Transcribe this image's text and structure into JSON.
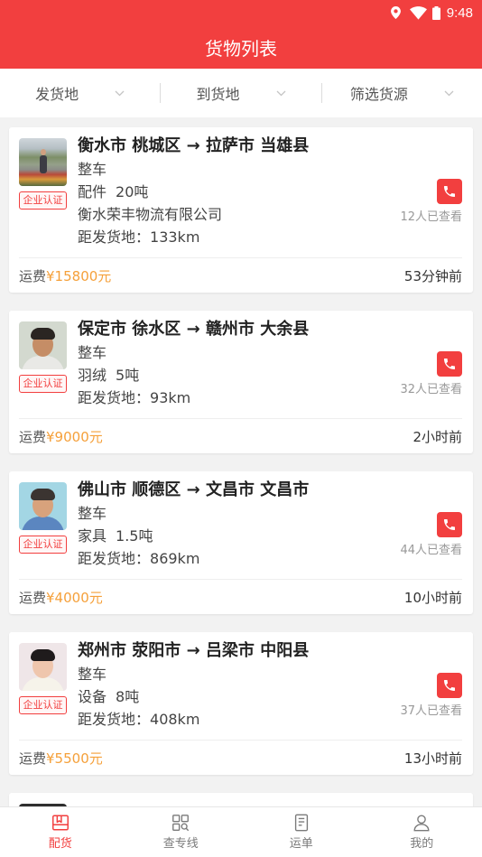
{
  "theme": {
    "primary": "#f23f3f",
    "fee": "#f5a03a",
    "background": "#f2f2f2"
  },
  "status_bar": {
    "time": "9:48",
    "icons": [
      "location-icon",
      "wifi-icon",
      "battery-icon"
    ]
  },
  "header": {
    "title": "货物列表"
  },
  "filters": [
    {
      "label": "发货地",
      "icon": "chevron-down-icon"
    },
    {
      "label": "到货地",
      "icon": "chevron-down-icon"
    },
    {
      "label": "筛选货源",
      "icon": "chevron-down-icon"
    }
  ],
  "route_arrow": "→",
  "cargo_list": [
    {
      "origin": "衡水市 桃城区",
      "destination": "拉萨市 当雄县",
      "badge": "企业认证",
      "vehicle": "整车",
      "goods": "配件",
      "weight": "20吨",
      "company": "衡水荣丰物流有限公司",
      "distance_label": "距发货地：",
      "distance": "133km",
      "views": "12人已查看",
      "fee_label": "运费",
      "fee": "¥15800元",
      "posted": "53分钟前"
    },
    {
      "origin": "保定市 徐水区",
      "destination": "赣州市 大余县",
      "badge": "企业认证",
      "vehicle": "整车",
      "goods": "羽绒",
      "weight": "5吨",
      "distance_label": "距发货地：",
      "distance": "93km",
      "views": "32人已查看",
      "fee_label": "运费",
      "fee": "¥9000元",
      "posted": "2小时前"
    },
    {
      "origin": "佛山市 顺德区",
      "destination": "文昌市 文昌市",
      "badge": "企业认证",
      "vehicle": "整车",
      "goods": "家具",
      "weight": "1.5吨",
      "distance_label": "距发货地：",
      "distance": "869km",
      "views": "44人已查看",
      "fee_label": "运费",
      "fee": "¥4000元",
      "posted": "10小时前"
    },
    {
      "origin": "郑州市 荥阳市",
      "destination": "吕梁市 中阳县",
      "badge": "企业认证",
      "vehicle": "整车",
      "goods": "设备",
      "weight": "8吨",
      "distance_label": "距发货地：",
      "distance": "408km",
      "views": "37人已查看",
      "fee_label": "运费",
      "fee": "¥5500元",
      "posted": "13小时前"
    }
  ],
  "bottom_nav": {
    "items": [
      {
        "label": "配货",
        "icon": "cargo-icon",
        "active": true
      },
      {
        "label": "查专线",
        "icon": "route-search-icon",
        "active": false
      },
      {
        "label": "运单",
        "icon": "waybill-icon",
        "active": false
      },
      {
        "label": "我的",
        "icon": "profile-icon",
        "active": false
      }
    ]
  }
}
